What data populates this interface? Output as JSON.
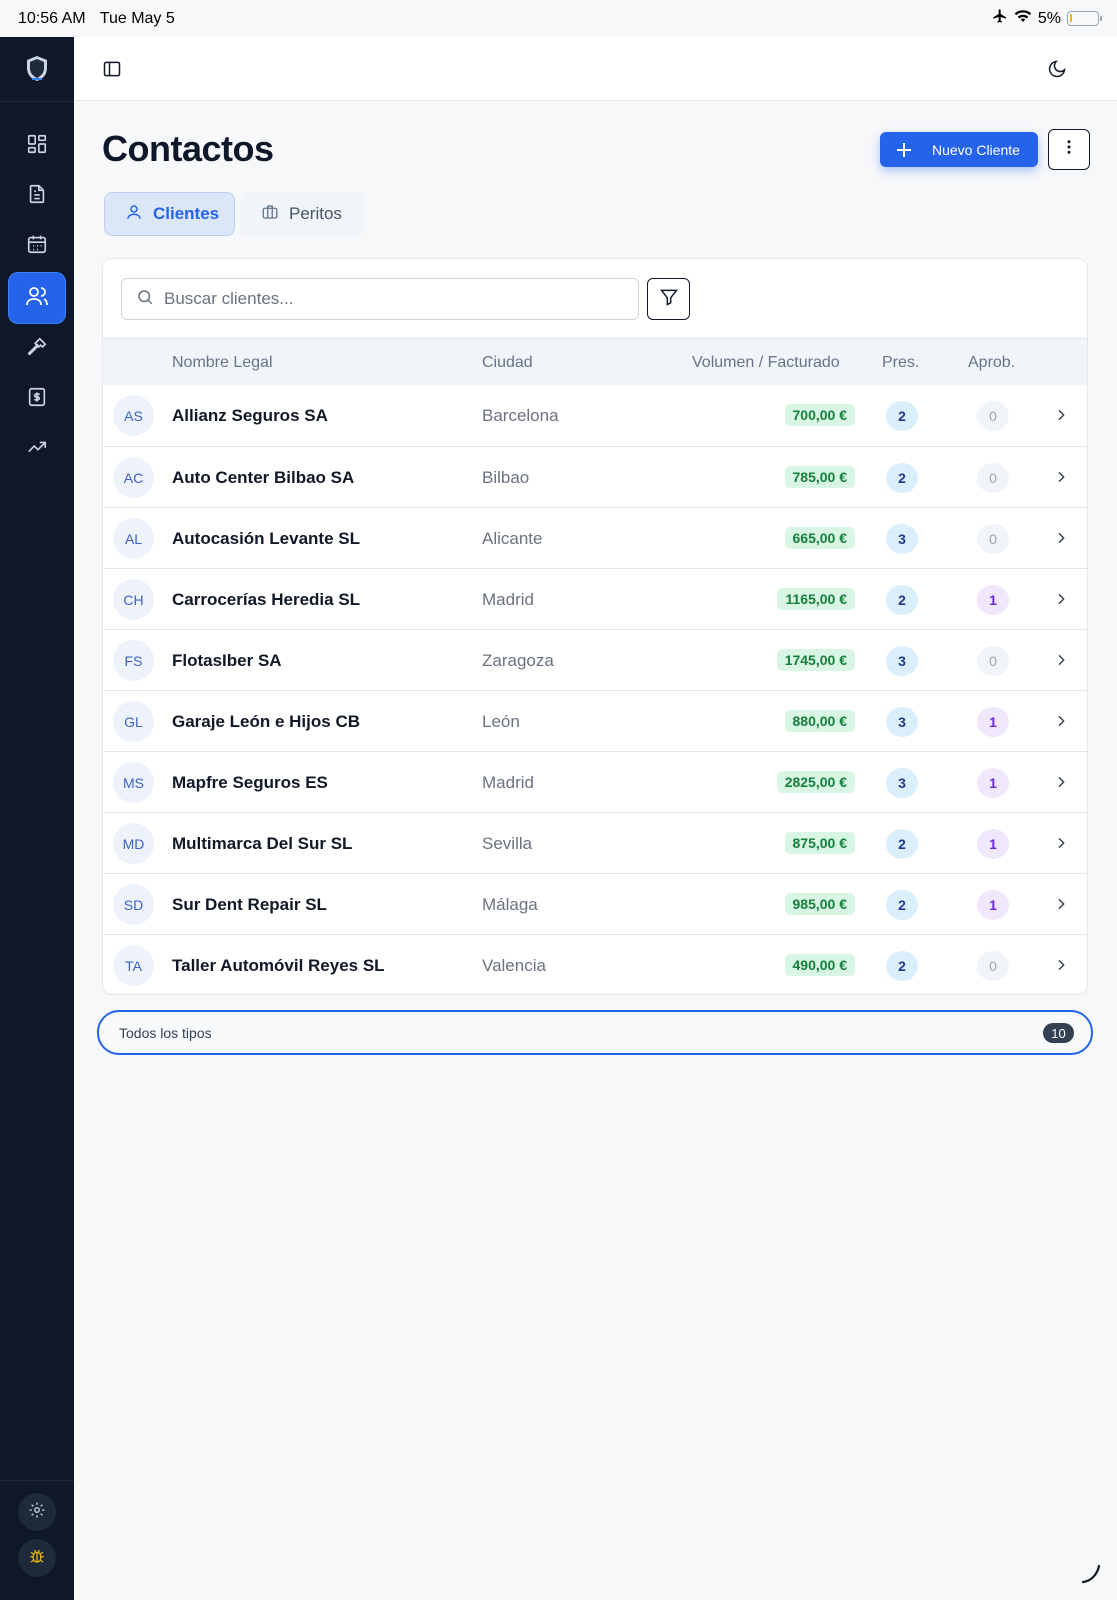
{
  "status": {
    "time": "10:56 AM",
    "date": "Tue May 5",
    "battery": "5%",
    "battery_level": 0.05
  },
  "sidebar": {
    "logo_icon": "shield-logo",
    "items": [
      {
        "icon": "dashboard-icon",
        "active": false
      },
      {
        "icon": "document-icon",
        "active": false
      },
      {
        "icon": "calendar-icon",
        "active": false
      },
      {
        "icon": "users-icon",
        "active": true
      },
      {
        "icon": "hammer-icon",
        "active": false
      },
      {
        "icon": "invoice-icon",
        "active": false
      },
      {
        "icon": "trending-up-icon",
        "active": false
      }
    ],
    "bottom": [
      {
        "icon": "gear-icon"
      },
      {
        "icon": "bug-icon"
      }
    ]
  },
  "header": {
    "title": "Contactos",
    "new_button": "Nuevo Cliente"
  },
  "tabs": [
    {
      "label": "Clientes",
      "active": true
    },
    {
      "label": "Peritos",
      "active": false
    }
  ],
  "search": {
    "placeholder": "Buscar clientes..."
  },
  "table": {
    "columns": {
      "name": "Nombre Legal",
      "city": "Ciudad",
      "volume": "Volumen / Facturado",
      "pres": "Pres.",
      "aprob": "Aprob."
    },
    "rows": [
      {
        "initials": "AS",
        "name": "Allianz Seguros SA",
        "city": "Barcelona",
        "volume": "700,00 €",
        "pres": "2",
        "aprob": "0"
      },
      {
        "initials": "AC",
        "name": "Auto Center Bilbao SA",
        "city": "Bilbao",
        "volume": "785,00 €",
        "pres": "2",
        "aprob": "0"
      },
      {
        "initials": "AL",
        "name": "Autocasión Levante SL",
        "city": "Alicante",
        "volume": "665,00 €",
        "pres": "3",
        "aprob": "0"
      },
      {
        "initials": "CH",
        "name": "Carrocerías Heredia SL",
        "city": "Madrid",
        "volume": "1165,00 €",
        "pres": "2",
        "aprob": "1"
      },
      {
        "initials": "FS",
        "name": "FlotasIber SA",
        "city": "Zaragoza",
        "volume": "1745,00 €",
        "pres": "3",
        "aprob": "0"
      },
      {
        "initials": "GL",
        "name": "Garaje León e Hijos CB",
        "city": "León",
        "volume": "880,00 €",
        "pres": "3",
        "aprob": "1"
      },
      {
        "initials": "MS",
        "name": "Mapfre Seguros ES",
        "city": "Madrid",
        "volume": "2825,00 €",
        "pres": "3",
        "aprob": "1"
      },
      {
        "initials": "MD",
        "name": "Multimarca Del Sur SL",
        "city": "Sevilla",
        "volume": "875,00 €",
        "pres": "2",
        "aprob": "1"
      },
      {
        "initials": "SD",
        "name": "Sur Dent Repair SL",
        "city": "Málaga",
        "volume": "985,00 €",
        "pres": "2",
        "aprob": "1"
      },
      {
        "initials": "TA",
        "name": "Taller Automóvil Reyes SL",
        "city": "Valencia",
        "volume": "490,00 €",
        "pres": "2",
        "aprob": "0"
      }
    ]
  },
  "footer_filter": {
    "label": "Todos los tipos",
    "count": "10"
  },
  "colors": {
    "accent": "#2563eb",
    "sidebar": "#0f172a",
    "volume_bg": "#d9f5e3",
    "volume_text": "#15803d"
  }
}
